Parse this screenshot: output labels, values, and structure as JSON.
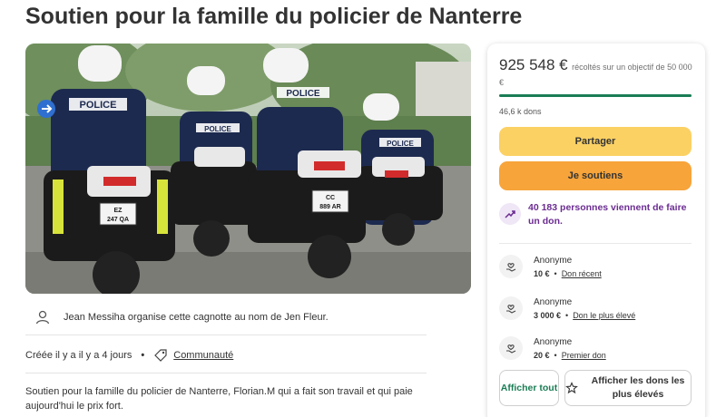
{
  "page": {
    "title": "Soutien pour la famille du policier de Nanterre"
  },
  "hero": {
    "labels": [
      "POLICE",
      "POLICE",
      "POLICE",
      "POLICE"
    ],
    "plates": [
      "EZ 247 QA",
      "CC 889 AR",
      "CC 889 AR"
    ]
  },
  "organizer": {
    "text": "Jean Messiha organise cette cagnotte au nom de Jen Fleur."
  },
  "meta": {
    "created": "Créée il y a il y a 4 jours",
    "category": "Communauté"
  },
  "description": "Soutien pour la famille du policier de Nanterre, Florian.M qui a fait son travail et qui paie aujourd'hui le prix fort.",
  "panel": {
    "raised_amount": "925 548 €",
    "raised_caption": "récoltés sur un objectif de 50 000 €",
    "progress_fraction": 1.0,
    "donation_count": "46,6 k dons",
    "share_label": "Partager",
    "donate_label": "Je soutiens",
    "trend_text": "40 183 personnes viennent de faire un don.",
    "donors": [
      {
        "name": "Anonyme",
        "amount": "10 €",
        "tag": "Don récent"
      },
      {
        "name": "Anonyme",
        "amount": "3 000 €",
        "tag": "Don le plus élevé"
      },
      {
        "name": "Anonyme",
        "amount": "20 €",
        "tag": "Premier don"
      }
    ],
    "show_all_label": "Afficher tout",
    "show_top_label": "Afficher les dons les plus élevés"
  },
  "colors": {
    "accent_green": "#1a7d55",
    "share_yellow": "#fbd164",
    "donate_orange": "#f7a43a",
    "trend_purple": "#6b2c91"
  }
}
